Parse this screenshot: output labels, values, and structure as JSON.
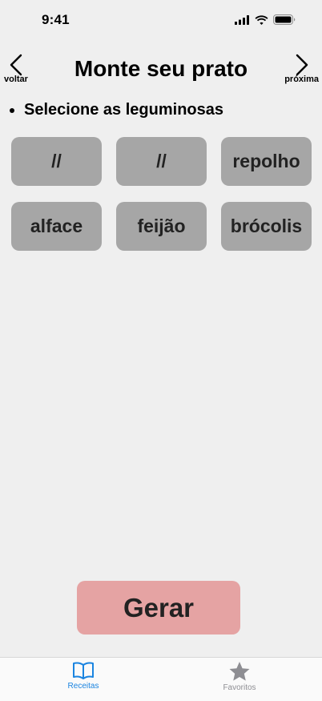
{
  "status": {
    "time": "9:41"
  },
  "header": {
    "title": "Monte seu prato",
    "back_label": "voltar",
    "next_label": "próxima"
  },
  "instruction": "Selecione as leguminosas",
  "options": [
    "//",
    "//",
    "repolho",
    "alface",
    "feijão",
    "brócolis"
  ],
  "action": {
    "generate_label": "Gerar"
  },
  "tabs": [
    {
      "label": "Receitas",
      "icon": "book-icon",
      "active": true
    },
    {
      "label": "Favoritos",
      "icon": "star-icon",
      "active": false
    }
  ],
  "colors": {
    "background": "#efefef",
    "option_bg": "#a6a6a6",
    "generate_bg": "#e5a3a3",
    "tab_active": "#1a84e0",
    "tab_inactive": "#8e8e93"
  }
}
